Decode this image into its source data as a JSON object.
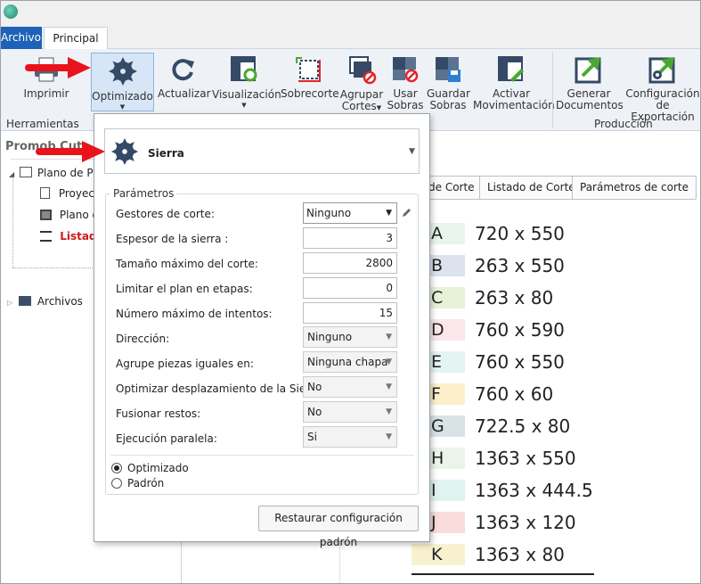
{
  "menu": {
    "archivo": "Archivo",
    "principal": "Principal"
  },
  "ribbon": {
    "imprimir": "Imprimir",
    "optimizado": "Optimizado",
    "actualizar": "Actualizar",
    "visualizacion": "Visualización",
    "sobrecorte": "Sobrecorte",
    "agrupar_1": "Agrupar",
    "agrupar_2": "Cortes",
    "usar_1": "Usar",
    "usar_2": "Sobras",
    "guardar_1": "Guardar",
    "guardar_2": "Sobras",
    "activar_1": "Activar",
    "activar_2": "Movimentación",
    "generar_1": "Generar",
    "generar_2": "Documentos",
    "config_1": "Configuración",
    "config_2": "de Exportación",
    "group_herramientas": "Herramientas",
    "group_produccion": "Producción"
  },
  "left_panel": {
    "title": "Promob Cut",
    "tree": {
      "plano_root": "Plano de Pr",
      "proyecto": "Proyect",
      "plano_child": "Plano d",
      "listado": "Listado",
      "archivos": "Archivos"
    }
  },
  "right_panel": {
    "tabs": [
      "de Corte",
      "Listado de Corte",
      "Parámetros de corte"
    ],
    "pieces": [
      {
        "letter": "A",
        "size": "720 x 550",
        "color": "#e9f5ec"
      },
      {
        "letter": "B",
        "size": "263 x 550",
        "color": "#dde3ec"
      },
      {
        "letter": "C",
        "size": "263 x 80",
        "color": "#e6f3d9"
      },
      {
        "letter": "D",
        "size": "760 x 590",
        "color": "#fbe7e9"
      },
      {
        "letter": "E",
        "size": "760 x 550",
        "color": "#e3f4f1"
      },
      {
        "letter": "F",
        "size": "760 x 60",
        "color": "#fbf0c9"
      },
      {
        "letter": "G",
        "size": "722.5 x 80",
        "color": "#d9e3e6"
      },
      {
        "letter": "H",
        "size": "1363 x 550",
        "color": "#eaf4ea"
      },
      {
        "letter": "I",
        "size": "1363 x 444.5",
        "color": "#e1f3ef"
      },
      {
        "letter": "J",
        "size": "1363 x 120",
        "color": "#f9dcdc"
      },
      {
        "letter": "K",
        "size": "1363 x 80",
        "color": "#f8f1cf"
      }
    ]
  },
  "popup": {
    "selector_label": "Sierra",
    "params_title": "Parámetros",
    "labels": {
      "gestores": "Gestores de corte:",
      "espesor": "Espesor de la sierra :",
      "tamano": "Tamaño máximo del corte:",
      "limitar": "Limitar el plan en etapas:",
      "intentos": "Número máximo de intentos:",
      "direccion": "Dirección:",
      "agrupe": "Agrupe piezas iguales en:",
      "optimizar_desp": "Optimizar desplazamiento de la Sierra:",
      "fusionar": "Fusionar restos:",
      "ejecucion": "Ejecución paralela:"
    },
    "values": {
      "gestores": "Ninguno",
      "espesor": "3",
      "tamano": "2800",
      "limitar": "0",
      "intentos": "15",
      "direccion": "Ninguno",
      "agrupe": "Ninguna chapa",
      "optimizar_desp": "No",
      "fusionar": "No",
      "ejecucion": "Si"
    },
    "radio_optimizado": "Optimizado",
    "radio_padron": "Padrón",
    "restore_button": "Restaurar configuración padrón"
  },
  "colors": {
    "accent": "#1d62b8",
    "arrow": "#e8131b",
    "listado_red": "#d01a1a"
  }
}
